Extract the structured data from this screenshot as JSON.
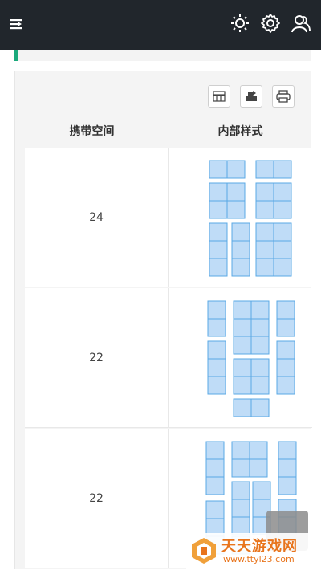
{
  "header": {
    "menu_icon": "menu-collapse-icon",
    "icons": [
      "sun-icon",
      "gear-icon",
      "user-icon"
    ]
  },
  "toolbar": {
    "buttons": [
      "columns-icon",
      "export-icon",
      "print-icon"
    ]
  },
  "table": {
    "columns": [
      "携带空间",
      "内部样式"
    ],
    "rows": [
      {
        "capacity": "24"
      },
      {
        "capacity": "22"
      },
      {
        "capacity": "22"
      }
    ]
  },
  "watermark": {
    "title": "天天游戏网",
    "url": "www.ttyl23.com"
  },
  "colors": {
    "topbar": "#21262c",
    "accent": "#1aa97b",
    "cell_fill": "#bfdcf7",
    "cell_stroke": "#5aa8e4"
  }
}
